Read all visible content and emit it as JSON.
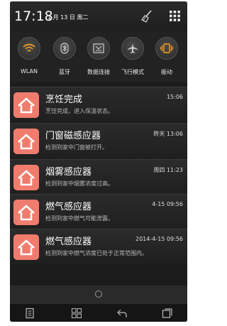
{
  "status": {
    "time": "17:18",
    "date": "1 月 13 日 周二"
  },
  "toggles": [
    {
      "label": "WLAN",
      "icon": "wifi-icon"
    },
    {
      "label": "蓝牙",
      "icon": "bluetooth-icon"
    },
    {
      "label": "数据连接",
      "icon": "data-connection-icon"
    },
    {
      "label": "飞行模式",
      "icon": "airplane-icon"
    },
    {
      "label": "振动",
      "icon": "vibrate-icon"
    }
  ],
  "notifications": [
    {
      "title": "烹饪完成",
      "desc": "烹饪完成，进入保温状态。",
      "time": "15:06"
    },
    {
      "title": "门窗磁感应器",
      "desc": "检测到家中门窗被打开。",
      "time": "昨天 13:06"
    },
    {
      "title": "烟雾感应器",
      "desc": "检测到家中烟雾浓度过高。",
      "time": "周四 11:23"
    },
    {
      "title": "燃气感应器",
      "desc": "检测到家中燃气可能泄露。",
      "time": "4-15 09:56"
    },
    {
      "title": "燃气感应器",
      "desc": "检测到家中燃气浓度已处于正常范围内。",
      "time": "2014-4-15 09:56"
    }
  ],
  "colors": {
    "accent": "#f07c6d",
    "wlan_active": "#f5a020",
    "vibrate_active": "#f5a020"
  }
}
